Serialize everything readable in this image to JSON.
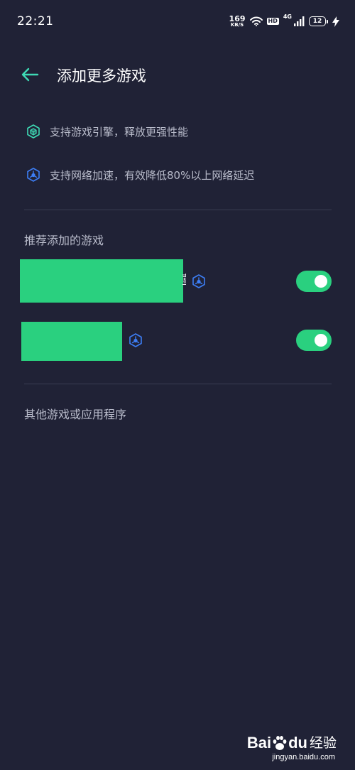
{
  "status_bar": {
    "time": "22:21",
    "net_speed": "169",
    "net_speed_unit": "KB/S",
    "hd_label": "HD",
    "signal_label": "4G",
    "battery_level": "12"
  },
  "header": {
    "back_icon": "arrow-left-icon",
    "title": "添加更多游戏"
  },
  "features": [
    {
      "icon": "game-engine-icon",
      "text": "支持游戏引擎，释放更强性能"
    },
    {
      "icon": "network-accel-icon",
      "text": "支持网络加速，有效降低80%以上网络延迟"
    }
  ],
  "recommended": {
    "title": "推荐添加的游戏",
    "games": [
      {
        "name_visible_fragment": "菫",
        "accel_icon": "network-accel-icon",
        "enabled": true
      },
      {
        "name_visible_fragment": "",
        "accel_icon": "network-accel-icon",
        "enabled": true
      }
    ]
  },
  "other": {
    "title": "其他游戏或应用程序"
  },
  "watermark": {
    "logo_text_a": "Bai",
    "logo_text_b": "du",
    "logo_text_c": "经验",
    "url": "jingyan.baidu.com"
  },
  "colors": {
    "background": "#202236",
    "accent_teal": "#3ed9b4",
    "accent_blue": "#3d7ef5",
    "toggle_on": "#2ad07f",
    "divider": "#3a3d52",
    "secondary_text": "#b9bccb"
  }
}
